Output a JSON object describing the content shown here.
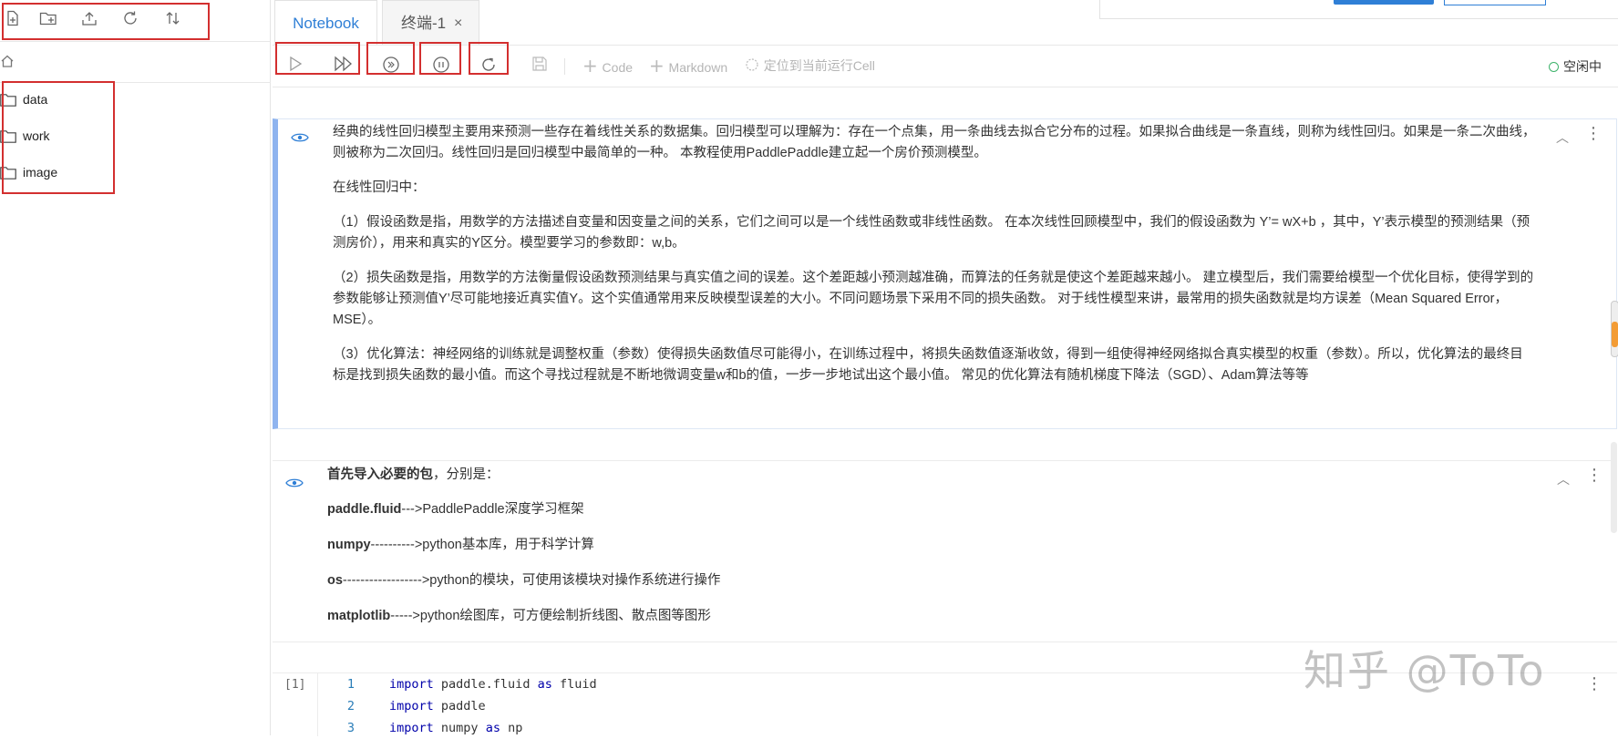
{
  "sidebar": {
    "toolbar_icons": [
      "new-file-icon",
      "new-folder-icon",
      "upload-icon",
      "refresh-icon",
      "sort-icon"
    ],
    "home_icon": "home-icon",
    "files": [
      {
        "name": "data",
        "icon": "folder-icon"
      },
      {
        "name": "work",
        "icon": "folder-icon"
      },
      {
        "name": "image",
        "icon": "folder-icon"
      }
    ]
  },
  "tabs": [
    {
      "label": "Notebook",
      "active": true
    },
    {
      "label": "终端-1",
      "active": false,
      "close": "×"
    }
  ],
  "toolbar": {
    "buttons": [
      "run-icon",
      "run-all-icon",
      "run-to-icon",
      "interrupt-icon",
      "restart-icon",
      "save-icon"
    ],
    "add_code": "Code",
    "add_markdown": "Markdown",
    "locate": "定位到当前运行Cell",
    "status": "空闲中"
  },
  "cells": {
    "md1": {
      "paragraphs": [
        "经典的线性回归模型主要用来预测一些存在着线性关系的数据集。回归模型可以理解为：存在一个点集，用一条曲线去拟合它分布的过程。如果拟合曲线是一条直线，则称为线性回归。如果是一条二次曲线，则被称为二次回归。线性回归是回归模型中最简单的一种。 本教程使用PaddlePaddle建立起一个房价预测模型。",
        "在线性回归中：",
        "（1）假设函数是指，用数学的方法描述自变量和因变量之间的关系，它们之间可以是一个线性函数或非线性函数。 在本次线性回顾模型中，我们的假设函数为 Y’= wX+b ，其中，Y’表示模型的预测结果（预测房价），用来和真实的Y区分。模型要学习的参数即：w,b。",
        "（2）损失函数是指，用数学的方法衡量假设函数预测结果与真实值之间的误差。这个差距越小预测越准确，而算法的任务就是使这个差距越来越小。 建立模型后，我们需要给模型一个优化目标，使得学到的参数能够让预测值Y’尽可能地接近真实值Y。这个实值通常用来反映模型误差的大小。不同问题场景下采用不同的损失函数。 对于线性模型来讲，最常用的损失函数就是均方误差（Mean Squared Error， MSE）。",
        "（3）优化算法：神经网络的训练就是调整权重（参数）使得损失函数值尽可能得小，在训练过程中，将损失函数值逐渐收敛，得到一组使得神经网络拟合真实模型的权重（参数）。所以，优化算法的最终目标是找到损失函数的最小值。而这个寻找过程就是不断地微调变量w和b的值，一步一步地试出这个最小值。 常见的优化算法有随机梯度下降法（SGD）、Adam算法等等"
      ]
    },
    "md2": {
      "intro_bold": "首先导入必要的包",
      "intro_rest": "，分别是：",
      "items": [
        {
          "name": "paddle.fluid",
          "desc": "--->PaddlePaddle深度学习框架"
        },
        {
          "name": "numpy",
          "desc": "---------->python基本库，用于科学计算"
        },
        {
          "name": "os",
          "desc": "------------------>python的模块，可使用该模块对操作系统进行操作"
        },
        {
          "name": "matplotlib",
          "desc": "----->python绘图库，可方便绘制折线图、散点图等图形"
        }
      ]
    },
    "code": {
      "exec_count": "[1]",
      "lines": [
        {
          "n": "1",
          "kw": "import",
          "rest": " paddle.fluid ",
          "kw2": "as",
          "rest2": " fluid"
        },
        {
          "n": "2",
          "kw": "import",
          "rest": " paddle",
          "kw2": "",
          "rest2": ""
        },
        {
          "n": "3",
          "kw": "import",
          "rest": " numpy ",
          "kw2": "as",
          "rest2": " np"
        }
      ]
    }
  },
  "watermark": "知乎 @ToTo",
  "colors": {
    "accent": "#2f7fd6",
    "annotation": "#d32f2f",
    "status_idle": "#3eb36b",
    "cell_selected": "#8fb4ef"
  }
}
